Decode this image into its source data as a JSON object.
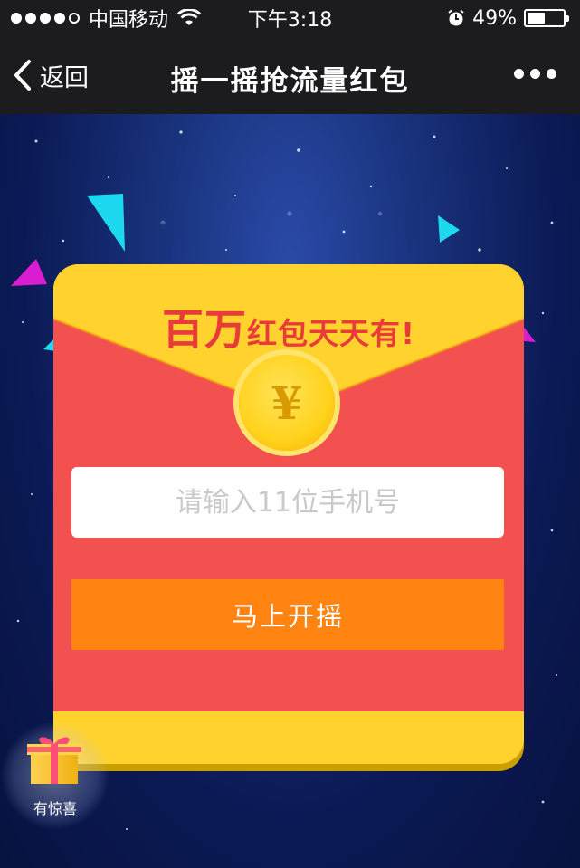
{
  "status_bar": {
    "carrier": "中国移动",
    "time": "下午3:18",
    "battery": "49%",
    "battery_level": 0.49,
    "signal_bars": 4,
    "signal_total": 5
  },
  "nav": {
    "back_label": "返回",
    "title": "摇一摇抢流量红包"
  },
  "envelope": {
    "headline_big": "百万",
    "headline_small": "红包天天有!",
    "coin_symbol": "¥",
    "phone_placeholder": "请输入11位手机号",
    "shake_button": "马上开摇"
  },
  "surprise": {
    "label": "有惊喜"
  },
  "colors": {
    "envelope_red": "#f35050",
    "envelope_yellow": "#ffd22e",
    "button_orange": "#ff8412",
    "headline_red": "#ea3b3b",
    "confetti_cyan": "#1ed8f0",
    "confetti_magenta": "#d81ed0"
  },
  "icons": [
    "wifi-icon",
    "alarm-icon",
    "battery-icon",
    "back-chevron-icon",
    "more-icon",
    "coin-icon",
    "gift-icon"
  ]
}
